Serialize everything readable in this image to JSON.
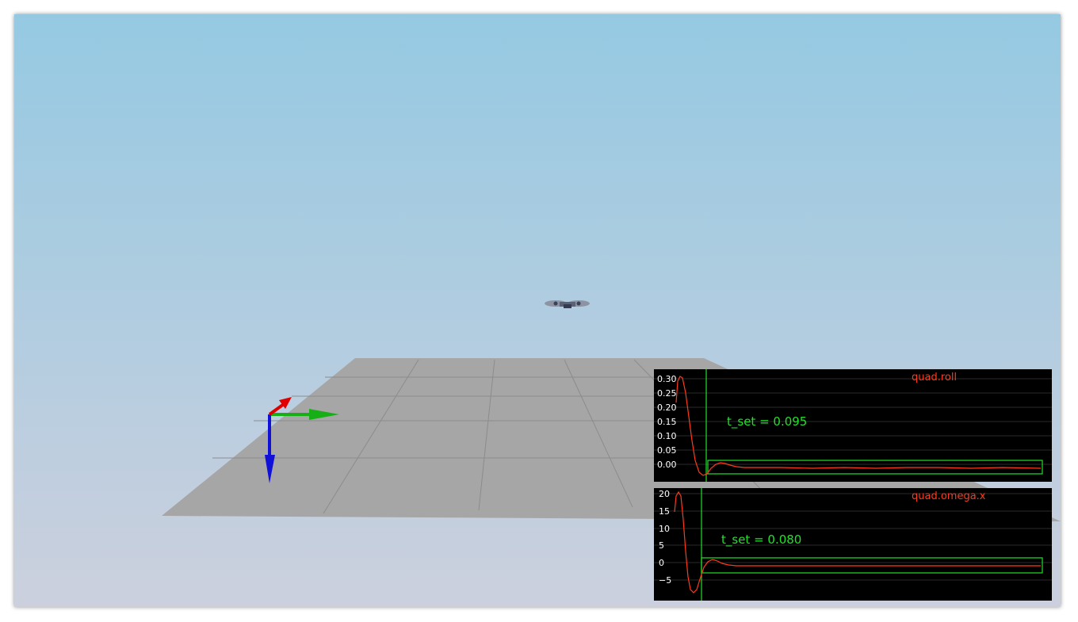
{
  "colors": {
    "sky_top": "#95c9e2",
    "sky_bottom": "#ccd0de",
    "ground": "#a6a6a6",
    "grid": "#8c8c8c",
    "trace": "#ff3a1a",
    "settle": "#22e02a",
    "axis_x": "#e00000",
    "axis_y": "#16b016",
    "axis_z": "#1010d8"
  },
  "icons": {
    "vehicle": "quadcopter-icon",
    "frame": "coordinate-axes-icon"
  },
  "plots": [
    {
      "id": "roll",
      "title": "quad.roll",
      "y_ticks": [
        "0.30",
        "0.25",
        "0.20",
        "0.15",
        "0.10",
        "0.05",
        "0.00"
      ],
      "settle_label": "t_set  =  0.095"
    },
    {
      "id": "omega",
      "title": "quad.omega.x",
      "y_ticks": [
        "20",
        "15",
        "10",
        "5",
        "0",
        "−5"
      ],
      "settle_label": "t_set  =  0.080"
    }
  ]
}
